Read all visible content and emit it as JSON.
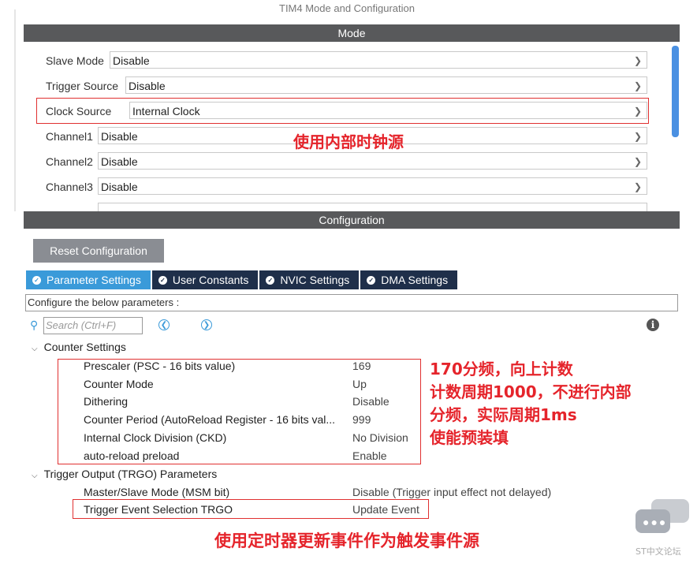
{
  "window_title": "TIM4 Mode and Configuration",
  "mode_panel": {
    "header": "Mode",
    "rows": [
      {
        "label": "Slave Mode",
        "value": "Disable"
      },
      {
        "label": "Trigger Source",
        "value": "Disable"
      },
      {
        "label": "Clock Source",
        "value": "Internal Clock"
      },
      {
        "label": "Channel1",
        "value": "Disable"
      },
      {
        "label": "Channel2",
        "value": "Disable"
      },
      {
        "label": "Channel3",
        "value": "Disable"
      }
    ]
  },
  "config_panel": {
    "header": "Configuration",
    "reset_button": "Reset Configuration",
    "tabs": [
      {
        "label": "Parameter Settings",
        "active": true
      },
      {
        "label": "User Constants",
        "active": false
      },
      {
        "label": "NVIC Settings",
        "active": false
      },
      {
        "label": "DMA Settings",
        "active": false
      }
    ],
    "configure_text": "Configure the below parameters :",
    "search_placeholder": "Search (Ctrl+F)",
    "groups": [
      {
        "title": "Counter Settings",
        "params": [
          {
            "name": "Prescaler (PSC - 16 bits value)",
            "value": "169"
          },
          {
            "name": "Counter Mode",
            "value": "Up"
          },
          {
            "name": "Dithering",
            "value": "Disable"
          },
          {
            "name": "Counter Period (AutoReload Register - 16 bits val...",
            "value": "999"
          },
          {
            "name": "Internal Clock Division (CKD)",
            "value": "No Division"
          },
          {
            "name": "auto-reload preload",
            "value": "Enable"
          }
        ]
      },
      {
        "title": "Trigger Output (TRGO) Parameters",
        "params": [
          {
            "name": "Master/Slave Mode (MSM bit)",
            "value": "Disable (Trigger input effect not delayed)"
          },
          {
            "name": "Trigger Event Selection TRGO",
            "value": "Update Event"
          }
        ]
      }
    ]
  },
  "annotations": {
    "clock_note": "使用内部时钟源",
    "counter_note_lines": [
      "170分频，向上计数",
      "计数周期1000，不进行内部",
      "分频，实际周期1ms",
      "使能预装填"
    ],
    "trgo_note": "使用定时器更新事件作为触发事件源"
  },
  "watermark": {
    "text": "ST中文论坛"
  },
  "colors": {
    "annotation_red": "#e5242b",
    "header_bar": "#58595b",
    "active_tab": "#3a9ad9",
    "inactive_tab": "#1f2f4a",
    "reset_button": "#8a8d93"
  },
  "icons": {
    "dropdown": "chevron-down-icon",
    "tab_check": "check-circle-icon",
    "search": "search-icon",
    "prev": "arrow-left-circle-icon",
    "next": "arrow-right-circle-icon",
    "info": "info-icon",
    "group_toggle": "chevron-down-icon"
  }
}
